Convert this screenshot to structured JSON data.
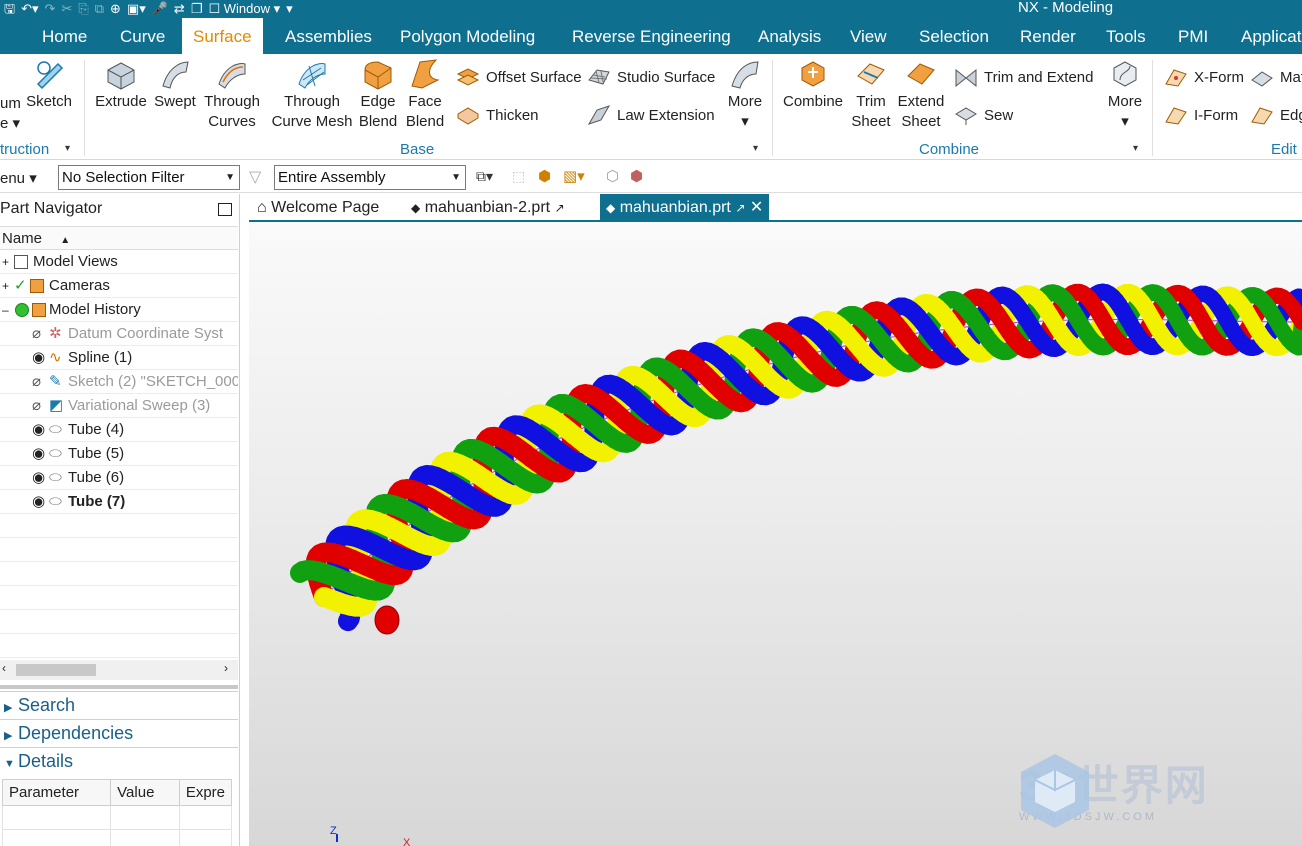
{
  "titlebar": {
    "window_menu": "Window",
    "app_title": "NX - Modeling"
  },
  "menu_tabs": [
    "Home",
    "Curve",
    "Surface",
    "Assemblies",
    "Polygon Modeling",
    "Reverse Engineering",
    "Analysis",
    "View",
    "Selection",
    "Render",
    "Tools",
    "PMI",
    "Applicat"
  ],
  "active_tab": "Surface",
  "ribbon": {
    "partial_left": {
      "line1": "um",
      "line2": "e",
      "sketch": "Sketch",
      "group": "truction"
    },
    "base": {
      "extrude": "Extrude",
      "swept": "Swept",
      "through_curves_1": "Through",
      "through_curves_2": "Curves",
      "through_mesh_1": "Through",
      "through_mesh_2": "Curve Mesh",
      "edge_blend_1": "Edge",
      "edge_blend_2": "Blend",
      "face_blend_1": "Face",
      "face_blend_2": "Blend",
      "offset_surface": "Offset Surface",
      "thicken": "Thicken",
      "studio_surface": "Studio Surface",
      "law_extension": "Law Extension",
      "more": "More",
      "group": "Base"
    },
    "combine": {
      "combine": "Combine",
      "trim_sheet_1": "Trim",
      "trim_sheet_2": "Sheet",
      "extend_sheet_1": "Extend",
      "extend_sheet_2": "Sheet",
      "trim_extend": "Trim and Extend",
      "sew": "Sew",
      "more": "More",
      "group": "Combine"
    },
    "edit": {
      "xform": "X-Form",
      "iform": "I-Form",
      "mat": "Mat",
      "edg": "Edg",
      "group": "Edit"
    }
  },
  "selection_bar": {
    "menu": "enu",
    "filter": "No Selection Filter",
    "scope": "Entire Assembly"
  },
  "navigator": {
    "title": "Part Navigator",
    "column": "Name",
    "rows": [
      {
        "label": "Model Views"
      },
      {
        "label": "Cameras"
      },
      {
        "label": "Model History"
      },
      {
        "label": "Datum Coordinate Syst"
      },
      {
        "label": "Spline (1)"
      },
      {
        "label": "Sketch (2) \"SKETCH_000"
      },
      {
        "label": "Variational Sweep (3)"
      },
      {
        "label": "Tube (4)"
      },
      {
        "label": "Tube (5)"
      },
      {
        "label": "Tube (6)"
      },
      {
        "label": "Tube (7)"
      }
    ],
    "panels": {
      "search": "Search",
      "dependencies": "Dependencies",
      "details": "Details"
    },
    "details_columns": [
      "Parameter",
      "Value",
      "Expre"
    ]
  },
  "doc_tabs": [
    {
      "label": "Welcome Page"
    },
    {
      "label": "mahuanbian-2.prt"
    },
    {
      "label": "mahuanbian.prt"
    }
  ],
  "viewport": {
    "tube_colors": [
      "#f2f200",
      "#1010e0",
      "#e00000",
      "#10a010"
    ],
    "axis_labels": {
      "z": "Z",
      "x": "X"
    },
    "watermark": {
      "title": "3D世界网",
      "sub": "WWW.3DSJW.COM"
    }
  },
  "colors": {
    "accent": "#0f6f8f",
    "active_tab_text": "#e58a00",
    "group_label": "#1a7ab0"
  }
}
